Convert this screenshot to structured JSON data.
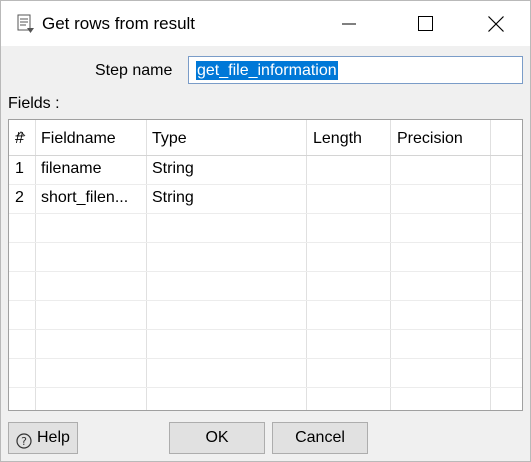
{
  "window": {
    "title": "Get rows from result"
  },
  "form": {
    "step_name_label": "Step name",
    "step_name_value": "get_file_information",
    "fields_label": "Fields :"
  },
  "table": {
    "columns": [
      "#",
      "Fieldname",
      "Type",
      "Length",
      "Precision"
    ],
    "rows": [
      {
        "num": "1",
        "fieldname": "filename",
        "type": "String",
        "length": "",
        "precision": ""
      },
      {
        "num": "2",
        "fieldname": "short_filen...",
        "type": "String",
        "length": "",
        "precision": ""
      }
    ]
  },
  "buttons": {
    "help": "Help",
    "ok": "OK",
    "cancel": "Cancel"
  },
  "icons": {
    "app": "step-icon",
    "minimize": "minimize-icon",
    "maximize": "maximize-icon",
    "close": "close-icon",
    "help": "help-icon",
    "sort": "sort-icon"
  }
}
